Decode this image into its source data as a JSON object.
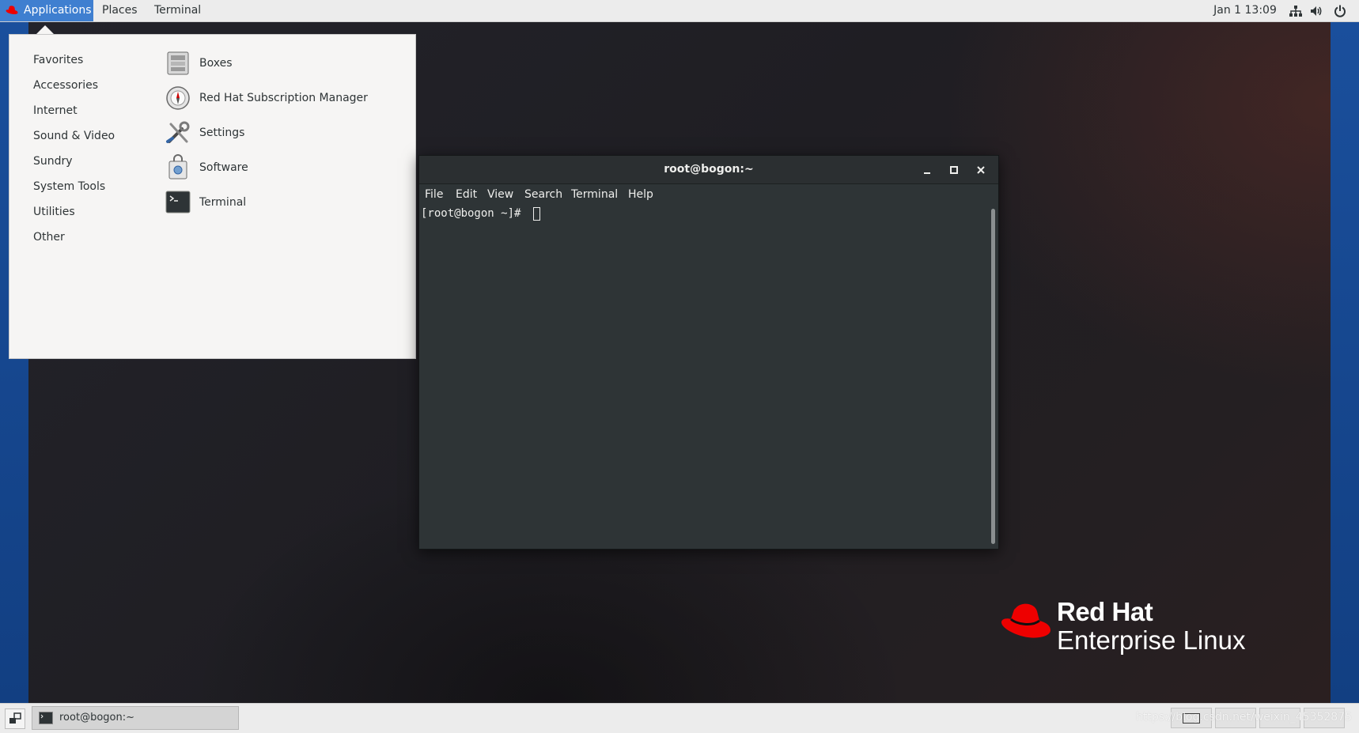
{
  "topbar": {
    "applications": "Applications",
    "places": "Places",
    "terminal": "Terminal",
    "clock": "Jan 1  13:09",
    "icons": [
      "network-icon",
      "volume-icon",
      "power-icon"
    ]
  },
  "app_menu": {
    "categories": [
      "Favorites",
      "Accessories",
      "Internet",
      "Sound & Video",
      "Sundry",
      "System Tools",
      "Utilities",
      "Other"
    ],
    "apps": [
      {
        "label": "Boxes",
        "icon": "boxes-icon"
      },
      {
        "label": "Red Hat Subscription Manager",
        "icon": "subscription-manager-icon"
      },
      {
        "label": "Settings",
        "icon": "settings-icon"
      },
      {
        "label": "Software",
        "icon": "software-icon"
      },
      {
        "label": "Terminal",
        "icon": "terminal-icon"
      }
    ]
  },
  "terminal_window": {
    "title": "root@bogon:~",
    "menu": [
      "File",
      "Edit",
      "View",
      "Search",
      "Terminal",
      "Help"
    ],
    "prompt": "[root@bogon ~]#"
  },
  "desktop": {
    "logo_line1": "Red Hat",
    "logo_line2": "Enterprise Linux",
    "logo_color": "#ee0000"
  },
  "taskbar": {
    "task_label": "root@bogon:~",
    "watermark": "https://blog.csdn.net/weixin_45352875"
  },
  "colors": {
    "accent": "#3f7fd0",
    "terminal_bg": "#2e3436",
    "topbar_bg": "#ececec"
  }
}
